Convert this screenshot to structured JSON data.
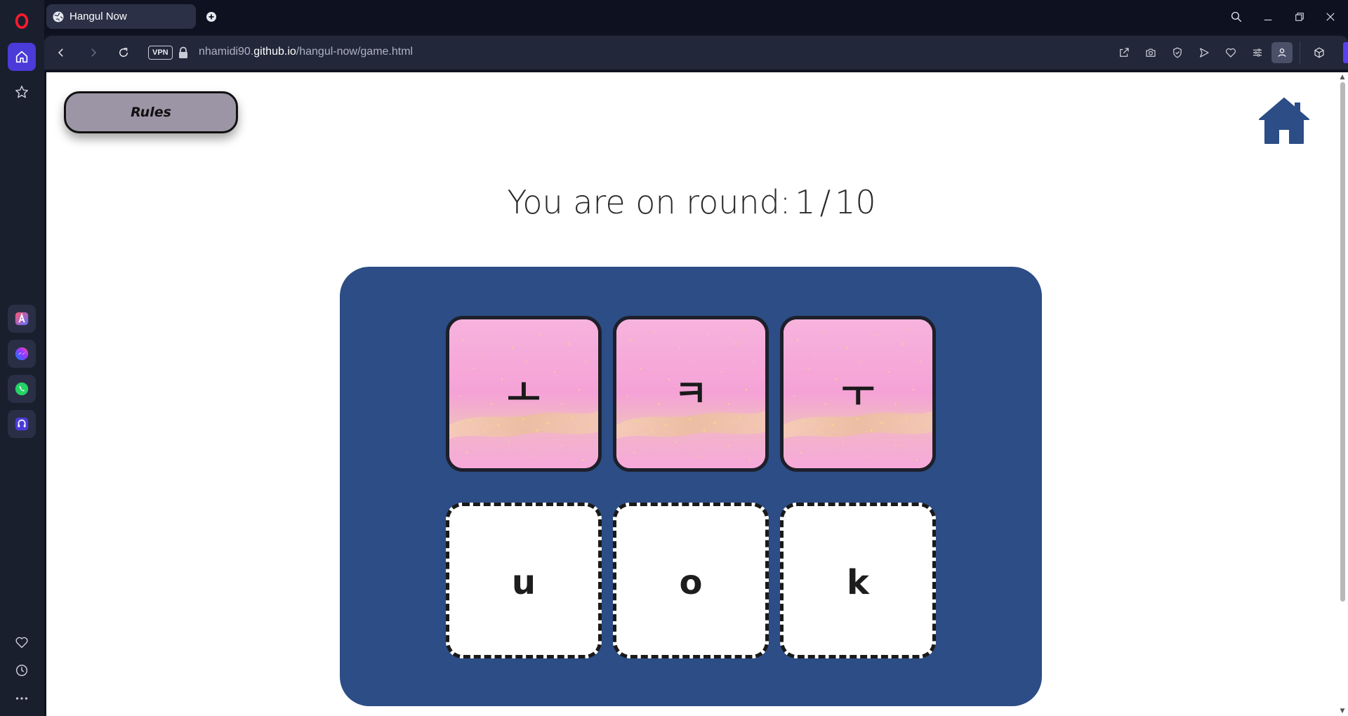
{
  "browser": {
    "tab_title": "Hangul Now",
    "url_prefix": "nhamidi90.",
    "url_domain": "github.io",
    "url_path": "/hangul-now/game.html",
    "vpn_label": "VPN"
  },
  "page": {
    "rules_label": "Rules",
    "round_prefix": "You are on round:",
    "round_current": "1",
    "round_separator": "/",
    "round_total": "10"
  },
  "game": {
    "hangul_cards": [
      {
        "char": "ㅗ"
      },
      {
        "char": "ㅋ"
      },
      {
        "char": "ㅜ"
      }
    ],
    "answer_slots": [
      {
        "char": "u"
      },
      {
        "char": "o"
      },
      {
        "char": "k"
      }
    ]
  },
  "colors": {
    "board": "#2c4d85",
    "home_icon": "#2c4d85",
    "rules_button": "#9c95a6",
    "card_pink": "#f6a9d8"
  }
}
